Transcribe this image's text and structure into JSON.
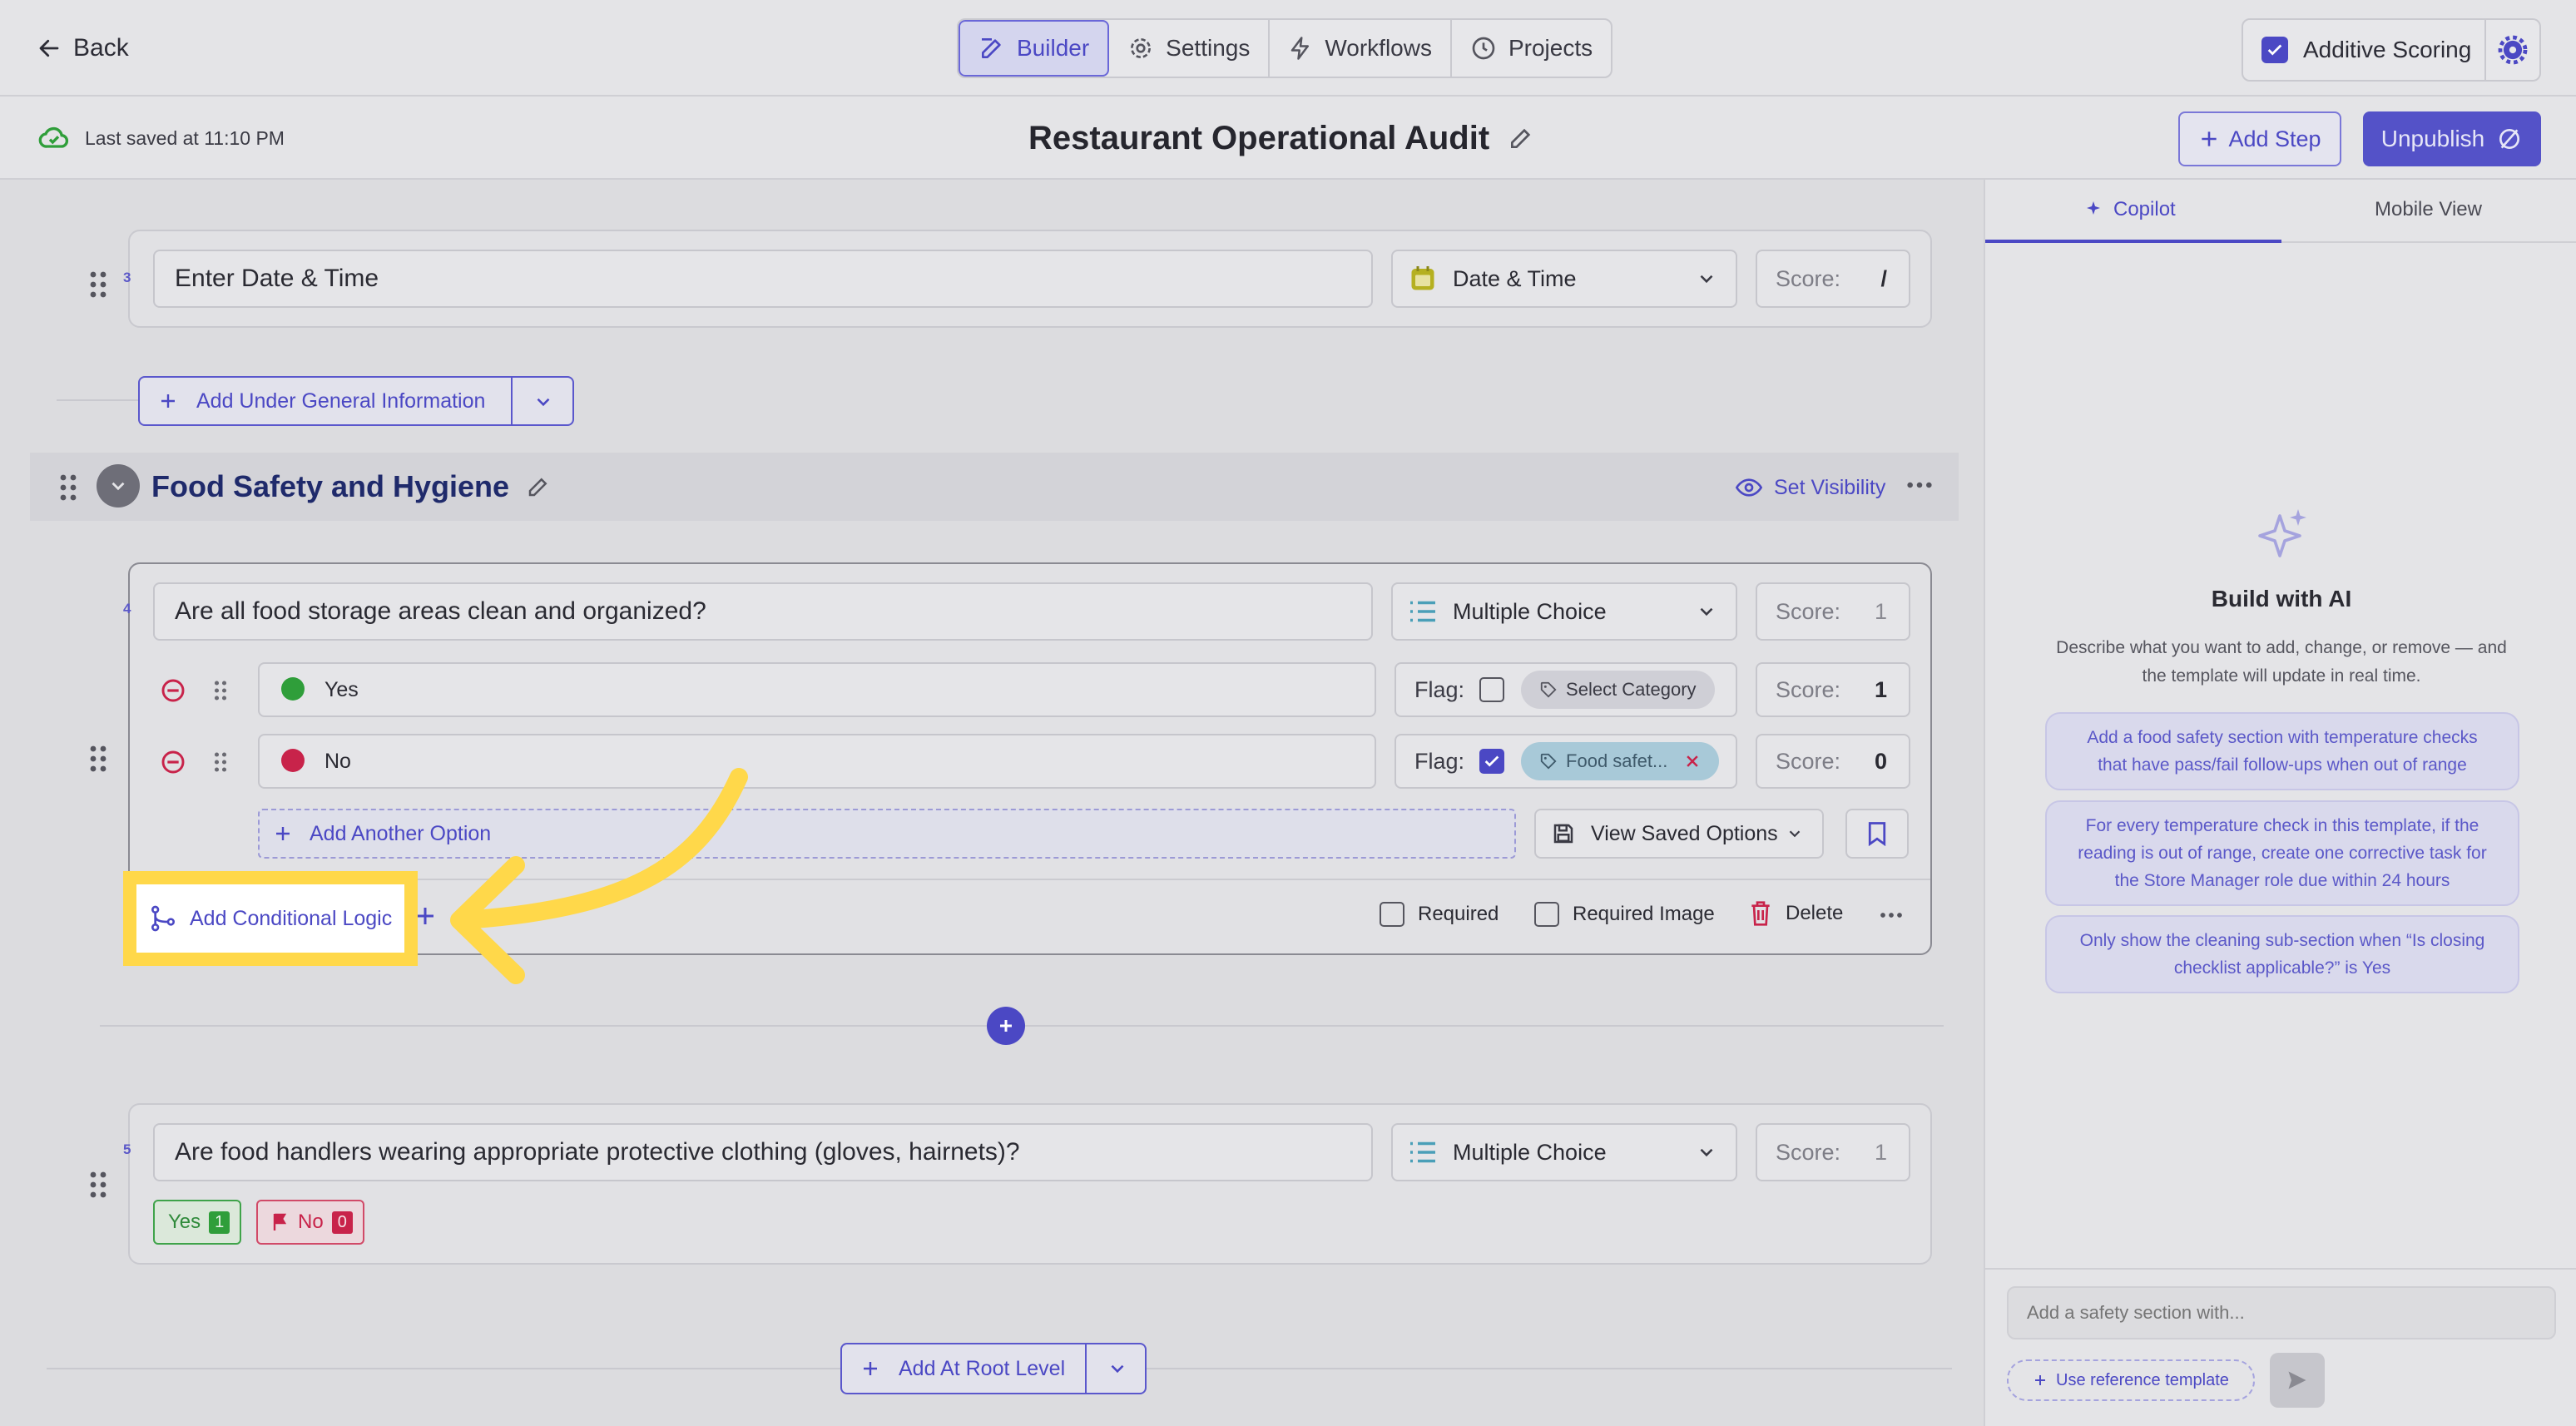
{
  "topbar": {
    "back_label": "Back",
    "tabs": [
      {
        "label": "Builder",
        "icon": "edit-icon",
        "active": true
      },
      {
        "label": "Settings",
        "icon": "gear-icon",
        "active": false
      },
      {
        "label": "Workflows",
        "icon": "bolt-icon",
        "active": false
      },
      {
        "label": "Projects",
        "icon": "clock-icon",
        "active": false
      }
    ],
    "additive_scoring_label": "Additive Scoring",
    "additive_scoring_checked": true
  },
  "subbar": {
    "saved_text": "Last saved at 11:10 PM",
    "title": "Restaurant Operational Audit",
    "add_step_label": "Add Step",
    "unpublish_label": "Unpublish"
  },
  "builder": {
    "q3": {
      "number": "3",
      "text": "Enter Date & Time",
      "type": "Date & Time",
      "score_label": "Score:",
      "score_value": "/"
    },
    "add_under_label": "Add Under General Information",
    "section": {
      "title": "Food Safety and Hygiene",
      "set_visibility_label": "Set Visibility"
    },
    "q4": {
      "number": "4",
      "text": "Are all food storage areas clean and organized?",
      "type": "Multiple Choice",
      "score_label": "Score:",
      "score_value": "1",
      "options": [
        {
          "label": "Yes",
          "color": "#2f9e3a",
          "flag_label": "Flag:",
          "flag_checked": false,
          "category": "Select Category",
          "score_label": "Score:",
          "score": "1"
        },
        {
          "label": "No",
          "color": "#c8234a",
          "flag_label": "Flag:",
          "flag_checked": true,
          "category": "Food safet...",
          "score_label": "Score:",
          "score": "0"
        }
      ],
      "add_option_label": "Add Another Option",
      "view_saved_label": "View Saved Options",
      "add_conditional_label": "Add Conditional Logic",
      "required_label": "Required",
      "required_image_label": "Required Image",
      "delete_label": "Delete"
    },
    "q5": {
      "number": "5",
      "text": "Are food handlers wearing appropriate protective clothing (gloves, hairnets)?",
      "type": "Multiple Choice",
      "score_label": "Score:",
      "score_value": "1",
      "chips": [
        {
          "label": "Yes",
          "count": "1"
        },
        {
          "label": "No",
          "count": "0"
        }
      ]
    },
    "add_root_label": "Add At Root Level"
  },
  "panel": {
    "tabs": [
      {
        "label": "Copilot",
        "active": true
      },
      {
        "label": "Mobile View",
        "active": false
      }
    ],
    "heading": "Build with AI",
    "description_line1": "Describe what you want to add, change, or remove — and",
    "description_line2": "the template will update in real time.",
    "suggestions": [
      {
        "line1": "Add a food safety section with temperature checks",
        "line2": "that have pass/fail follow-ups when out of range",
        "line3": ""
      },
      {
        "line1": "For every temperature check in this template, if the",
        "line2": "reading is out of range, create one corrective task for",
        "line3": "the Store Manager role due within 24 hours"
      },
      {
        "line1": "Only show the cleaning sub-section when “Is closing",
        "line2": "checklist applicable?” is Yes",
        "line3": ""
      }
    ],
    "input_placeholder": "Add a safety section with...",
    "reference_label": "Use reference template"
  },
  "colors": {
    "accent": "#4b48c4",
    "highlight": "#ffd84a",
    "arrow": "#ffd84a"
  }
}
